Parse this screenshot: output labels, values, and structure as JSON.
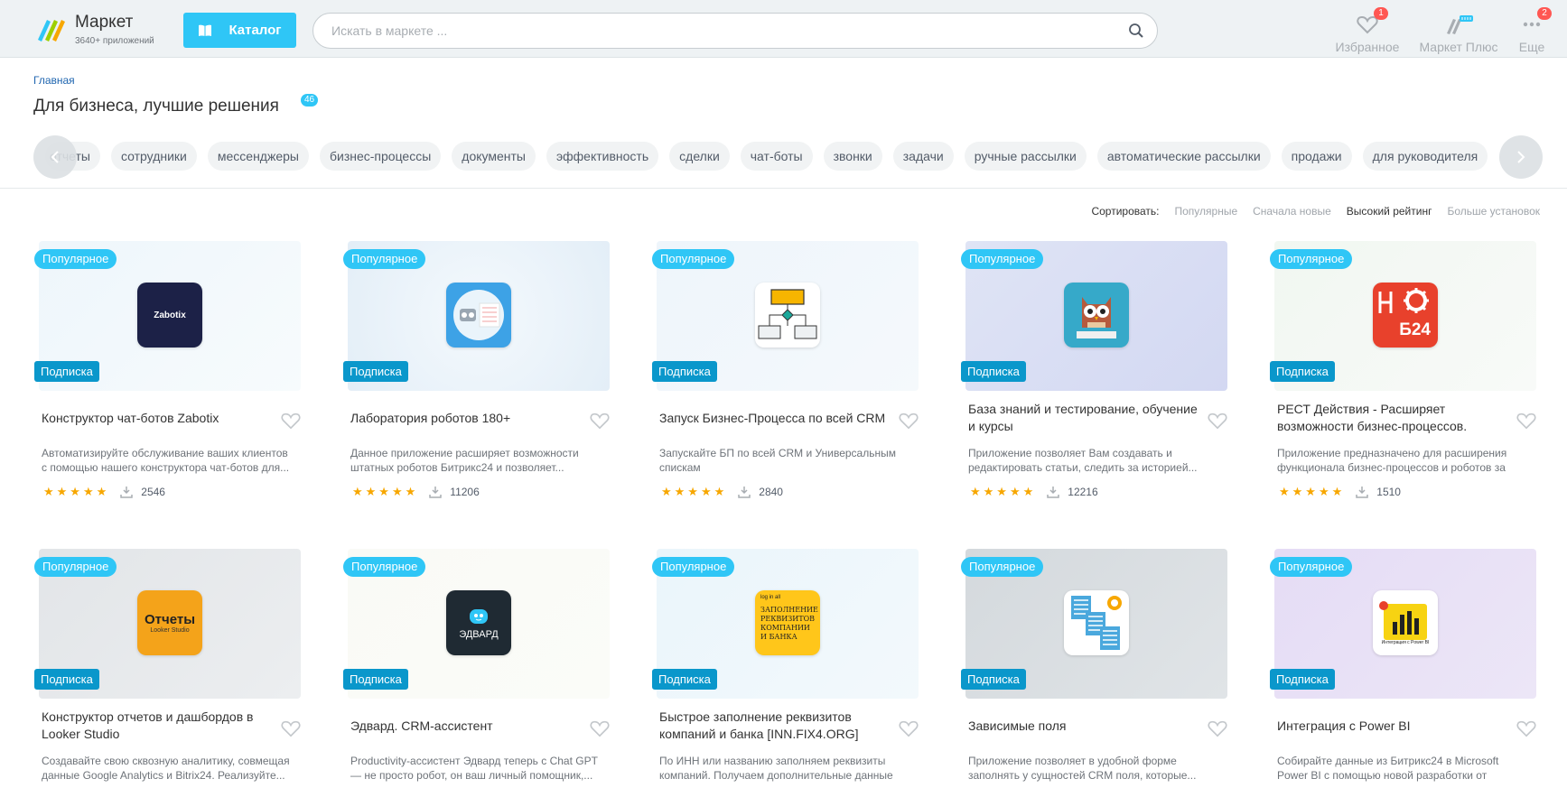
{
  "header": {
    "brand_title": "Маркет",
    "brand_sub": "3640+ приложений",
    "catalog_label": "Каталог",
    "search_placeholder": "Искать в маркете ...",
    "favorites": {
      "label": "Избранное",
      "badge": "1"
    },
    "market_plus": {
      "label": "Маркет Плюс"
    },
    "more": {
      "label": "Еще",
      "badge": "2"
    }
  },
  "breadcrumb": "Главная",
  "page_title": "Для бизнеса, лучшие решения",
  "title_count": "46",
  "tags": [
    "отчеты",
    "сотрудники",
    "мессенджеры",
    "бизнес-процессы",
    "документы",
    "эффективность",
    "сделки",
    "чат-боты",
    "звонки",
    "задачи",
    "ручные рассылки",
    "автоматические рассылки",
    "продажи",
    "для руководителя"
  ],
  "sort": {
    "label": "Сортировать:",
    "options": [
      "Популярные",
      "Сначала новые",
      "Высокий рейтинг",
      "Больше установок"
    ],
    "active": "Высокий рейтинг"
  },
  "badges": {
    "popular": "Популярное",
    "subscription": "Подписка"
  },
  "apps": [
    {
      "title": "Конструктор чат-ботов Zabotix",
      "desc": "Автоматизируйте обслуживание ваших клиентов с помощью нашего конструктора чат-ботов для...",
      "rating": 5,
      "installs": "2546",
      "icon_text": "Zabotix"
    },
    {
      "title": "Лаборатория роботов 180+",
      "desc": "Данное приложение расширяет возможности штатных роботов Битрикс24 и позволяет...",
      "rating": 5,
      "installs": "11206",
      "icon_text": ""
    },
    {
      "title": "Запуск Бизнес-Процесса по всей CRM",
      "desc": "Запускайте БП по всей CRM и Универсальным спискам",
      "rating": 5,
      "installs": "2840",
      "icon_text": ""
    },
    {
      "title": "База знаний и тестирование, обучение и курсы",
      "desc": "Приложение позволяет Вам создавать и редактировать статьи, следить за историей...",
      "rating": 5,
      "installs": "12216",
      "icon_text": ""
    },
    {
      "title": "РЕСТ Действия - Расширяет возможности бизнес-процессов.",
      "desc": "Приложение предназначено для расширения функционала бизнес-процессов и роботов за счё...",
      "rating": 5,
      "installs": "1510",
      "icon_text": "Б24"
    },
    {
      "title": "Конструктор отчетов и дашбордов в Looker Studio",
      "desc": "Создавайте свою сквозную аналитику, совмещая данные Google Analytics и Bitrix24. Реализуйте...",
      "icon_text": "Отчеты",
      "icon_sub": "Looker Studio"
    },
    {
      "title": "Эдвард. CRM-ассистент",
      "desc": "Productivity-ассистент Эдвард теперь с Chat GPT — не просто робот, он ваш личный помощник,...",
      "icon_text": "ЭДВАРД"
    },
    {
      "title": "Быстрое заполнение реквизитов компаний и банка [INN.FIX4.ORG]",
      "desc": "По ИНН или названию заполняем реквизиты компаний. Получаем дополнительные данные из...",
      "icon_text": "ЗАПОЛНЕНИЕ РЕКВИЗИТОВ КОМПАНИИ И БАНКА",
      "icon_sub": "log in all"
    },
    {
      "title": "Зависимые поля",
      "desc": "Приложение позволяет в удобной форме заполнять у сущностей CRM поля, которые...",
      "icon_text": ""
    },
    {
      "title": "Интеграция с Power BI",
      "desc": "Собирайте данные из Битрикс24 в Microsoft Power BI с помощью новой разработки от компании IT-...",
      "icon_text": "Интеграция с Power BI"
    }
  ],
  "colors": {
    "accent": "#2fc6f6",
    "subscription": "#0a97cb",
    "star": "#f7a700",
    "badge_red": "#ff5752"
  }
}
